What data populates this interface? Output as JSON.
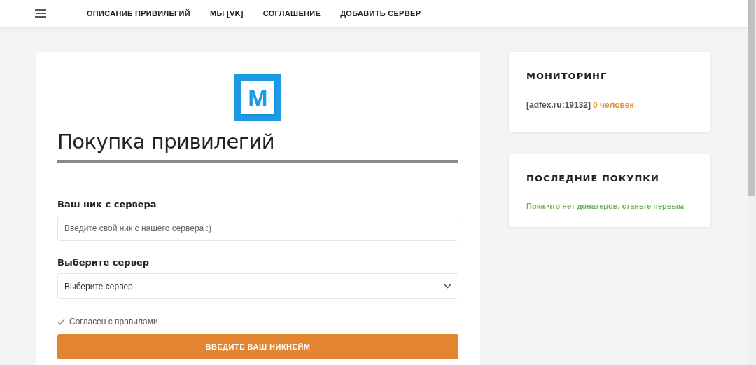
{
  "nav": {
    "items": [
      {
        "label": "ОПИСАНИЕ ПРИВИЛЕГИЙ"
      },
      {
        "label": "МЫ [VK]"
      },
      {
        "label": "СОГЛАШЕНИЕ"
      },
      {
        "label": "ДОБАВИТЬ СЕРВЕР"
      }
    ]
  },
  "main": {
    "logo_letter": "M",
    "title": "Покупка привилегий",
    "nick": {
      "label": "Ваш ник с сервера",
      "placeholder": "Введите свой ник с нашего сервера :)"
    },
    "server": {
      "label": "Выберите сервер",
      "value": "Выберите сервер"
    },
    "agree": {
      "label": "Согласен с правилами",
      "checked": true
    },
    "submit": "ВВЕДИТЕ ВАШ НИКНЕЙМ"
  },
  "monitoring": {
    "title": "МОНИТОРИНГ",
    "server": "[adfex.ru:19132]",
    "players": "0 человек"
  },
  "purchases": {
    "title": "ПОСЛЕДНИЕ ПОКУПКИ",
    "empty_text": "Пока-что нет донатеров, станьте первым"
  }
}
